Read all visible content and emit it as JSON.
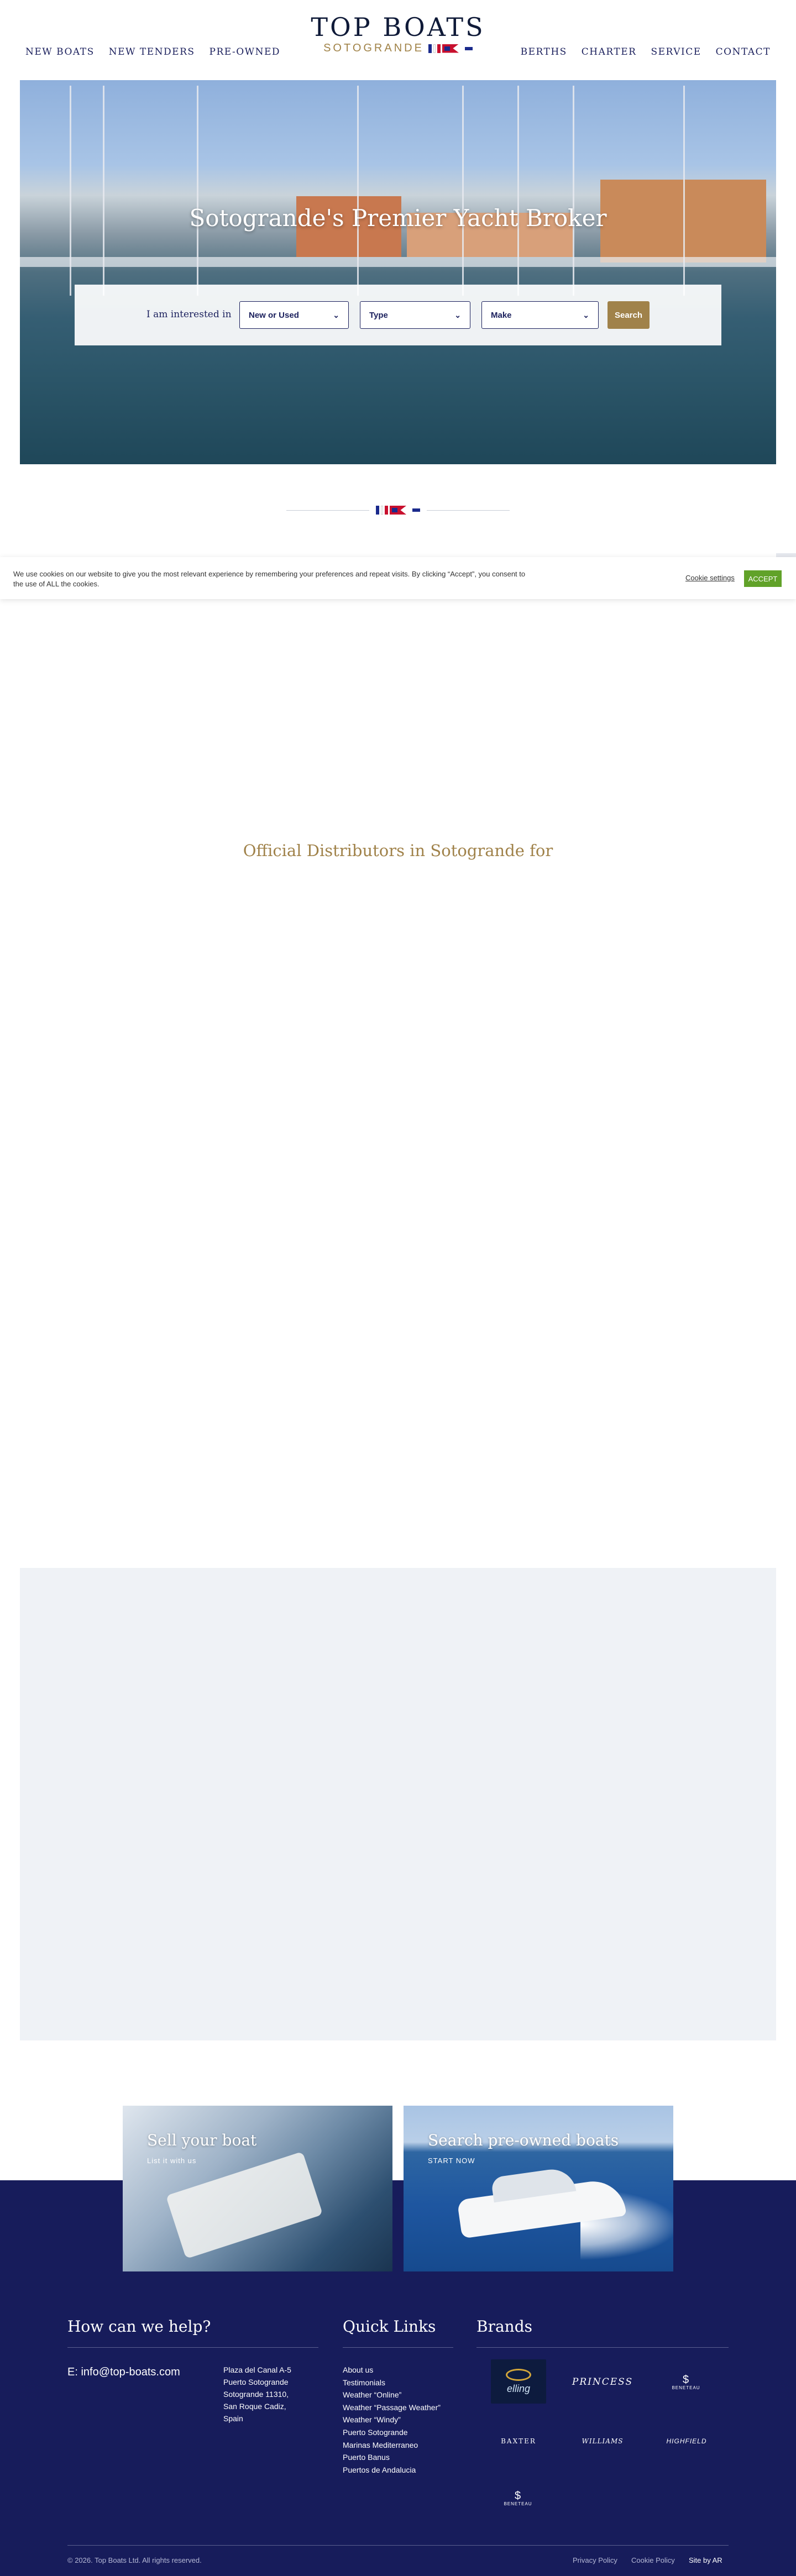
{
  "nav": {
    "left": [
      "NEW BOATS",
      "NEW TENDERS",
      "PRE-OWNED"
    ],
    "right": [
      "BERTHS",
      "CHARTER",
      "SERVICE",
      "CONTACT"
    ]
  },
  "logo": {
    "title": "TOP BOATS",
    "subtitle": "SOTOGRANDE"
  },
  "hero": {
    "title": "Sotogrande's Premier Yacht Broker",
    "search": {
      "label": "I am interested in",
      "condition": "New or Used",
      "type": "Type",
      "make": "Make",
      "button": "Search"
    }
  },
  "cookie": {
    "text": "We use cookies on our website to give you the most relevant experience by remembering your preferences and repeat visits. By clicking “Accept”, you consent to the use of ALL the cookies.",
    "settings": "Cookie settings",
    "accept": "ACCEPT"
  },
  "distributors": {
    "heading": "Official Distributors in Sotogrande for"
  },
  "promos": [
    {
      "title": "Sell your boat",
      "sub": "List it with us"
    },
    {
      "title": "Search pre-owned boats",
      "sub": "START NOW"
    }
  ],
  "footer": {
    "help": {
      "heading": "How can we help?",
      "email": "E: info@top-boats.com",
      "address": [
        "Plaza del Canal A-5",
        "Puerto Sotogrande",
        "Sotogrande 11310,",
        "San Roque Cadiz,",
        "Spain"
      ]
    },
    "quick_links": {
      "heading": "Quick Links",
      "items": [
        "About us",
        "Testimonials",
        "Weather “Online”",
        "Weather “Passage Weather”",
        "Weather “Windy”",
        "Puerto Sotogrande",
        "Marinas Mediterraneo",
        "Puerto Banus",
        "Puertos de Andalucia"
      ]
    },
    "brands": {
      "heading": "Brands",
      "items": [
        "elling",
        "PRINCESS",
        "BENETEAU",
        "BAXTER",
        "WILLIAMS",
        "HIGHFIELD",
        "BENETEAU"
      ]
    },
    "copyright": "© 2026. Top Boats Ltd. All rights reserved.",
    "privacy": "Privacy Policy",
    "cookie_policy": "Cookie Policy",
    "site_by": "Site by AR"
  },
  "colors": {
    "navy": "#171c5b",
    "gold": "#a0824a",
    "accept_green": "#61a229"
  }
}
